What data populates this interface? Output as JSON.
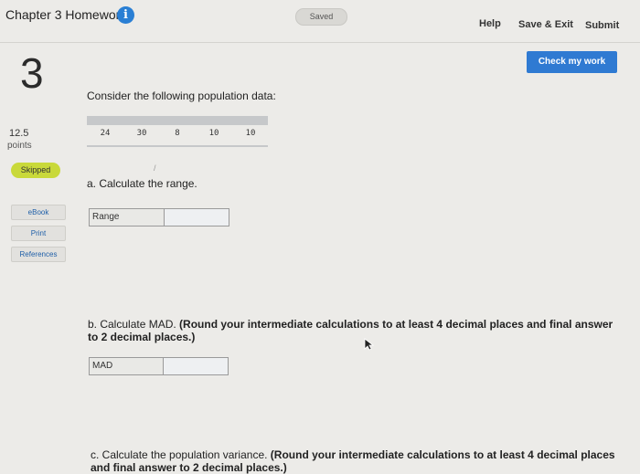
{
  "header": {
    "title": "Chapter 3 Homework",
    "info_icon": "info-icon",
    "saved_status": "Saved",
    "help": "Help",
    "save_exit": "Save & Exit",
    "submit": "Submit"
  },
  "question": {
    "number": "3",
    "points_value": "12.5",
    "points_label": "points",
    "status_badge": "Skipped",
    "check_work": "Check my work",
    "prompt": "Consider the following population data:",
    "data_values": [
      "24",
      "30",
      "8",
      "10",
      "10"
    ],
    "stray_mark": "/"
  },
  "resources": {
    "ebook": "eBook",
    "print": "Print",
    "references": "References"
  },
  "parts": {
    "a": {
      "text": "a. Calculate the range.",
      "field_label": "Range",
      "value": ""
    },
    "b": {
      "text": "b. Calculate MAD. ",
      "bold": "(Round your intermediate calculations to at least 4 decimal places and final answer to 2 decimal places.)",
      "field_label": "MAD",
      "value": ""
    },
    "c": {
      "text": "c. Calculate the population variance. ",
      "bold": "(Round your intermediate calculations to at least 4 decimal places and final answer to 2 decimal places.)"
    }
  },
  "colors": {
    "accent": "#2f7ad2",
    "badge": "#c9d93a",
    "background": "#ecebe8"
  }
}
